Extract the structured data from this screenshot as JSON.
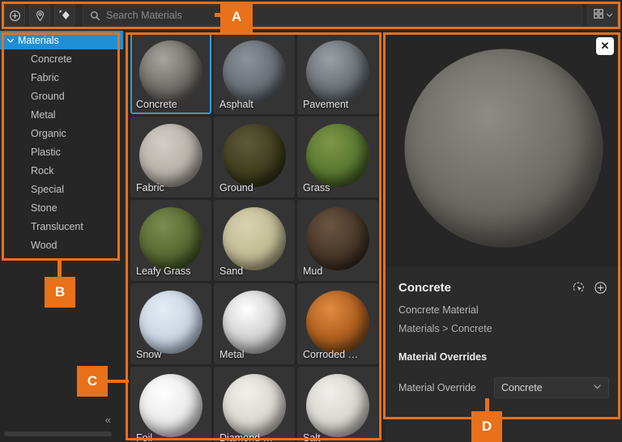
{
  "toolbar": {
    "buttons": [
      {
        "name": "add-material-button",
        "icon": "plus-circle-icon",
        "title": "Add"
      },
      {
        "name": "place-material-button",
        "icon": "pin-circle-icon",
        "title": "Place"
      },
      {
        "name": "pick-material-button",
        "icon": "diamond-cursor-icon",
        "title": "Pick"
      }
    ],
    "search": {
      "value": "",
      "placeholder": "Search Materials",
      "icon": "search-icon"
    },
    "view_button": {
      "name": "grid-view-button",
      "icon": "grid-view-icon",
      "chevron": "chevron-down-icon"
    }
  },
  "sidebar": {
    "root": {
      "label": "Materials",
      "caret": "chevron-down-icon",
      "selected": true
    },
    "items": [
      {
        "label": "Concrete"
      },
      {
        "label": "Fabric"
      },
      {
        "label": "Ground"
      },
      {
        "label": "Metal"
      },
      {
        "label": "Organic"
      },
      {
        "label": "Plastic"
      },
      {
        "label": "Rock"
      },
      {
        "label": "Special"
      },
      {
        "label": "Stone"
      },
      {
        "label": "Translucent"
      },
      {
        "label": "Wood"
      }
    ],
    "collapse_label": "«"
  },
  "grid": {
    "tiles": [
      {
        "label": "Concrete",
        "selected": true,
        "c1": "#a7a59f",
        "c2": "#72706b",
        "c3": "#54524e"
      },
      {
        "label": "Asphalt",
        "selected": false,
        "c1": "#8c9299",
        "c2": "#6a7077",
        "c3": "#4a4f55"
      },
      {
        "label": "Pavement",
        "selected": false,
        "c1": "#9aa0a6",
        "c2": "#6d7378",
        "c3": "#4d5257"
      },
      {
        "label": "Fabric",
        "selected": false,
        "c1": "#d3cdc7",
        "c2": "#b9b3ac",
        "c3": "#95908a"
      },
      {
        "label": "Ground",
        "selected": false,
        "c1": "#5d5a3c",
        "c2": "#42401f",
        "c3": "#2a2913"
      },
      {
        "label": "Grass",
        "selected": false,
        "c1": "#7d9548",
        "c2": "#5b7a32",
        "c3": "#3c531f"
      },
      {
        "label": "Leafy Grass",
        "selected": false,
        "c1": "#7d8b4e",
        "c2": "#5a6b33",
        "c3": "#3b4a22"
      },
      {
        "label": "Sand",
        "selected": false,
        "c1": "#d8d2b0",
        "c2": "#c2bc96",
        "c3": "#a39d78"
      },
      {
        "label": "Mud",
        "selected": false,
        "c1": "#6b5440",
        "c2": "#4a392a",
        "c3": "#2e241a"
      },
      {
        "label": "Snow",
        "selected": false,
        "c1": "#e4ebf3",
        "c2": "#ccd7e4",
        "c3": "#a9b6c6"
      },
      {
        "label": "Metal",
        "selected": false,
        "c1": "#ffffff",
        "c2": "#d2d2d2",
        "c3": "#a8a8a8"
      },
      {
        "label": "Corroded …",
        "selected": false,
        "c1": "#e08a42",
        "c2": "#b0601f",
        "c3": "#7a4718"
      },
      {
        "label": "Foil",
        "selected": false,
        "c1": "#ffffff",
        "c2": "#eaeaea",
        "c3": "#c6c6c6"
      },
      {
        "label": "Diamond …",
        "selected": false,
        "c1": "#f2f0ec",
        "c2": "#dcd9d3",
        "c3": "#b8b4ad"
      },
      {
        "label": "Salt",
        "selected": false,
        "c1": "#f0efeb",
        "c2": "#d9d8d2",
        "c3": "#b6b5ae"
      }
    ]
  },
  "detail": {
    "close_label": "✕",
    "preview": {
      "name": "material-preview-sphere",
      "c1": "#8d8b85",
      "c2": "#6e6c66",
      "c3": "#55534e"
    },
    "title": "Concrete",
    "subtitle": "Concrete Material",
    "path": "Materials > Concrete",
    "select_icon": "select-instances-icon",
    "add_icon": "plus-circle-icon",
    "overrides_title": "Material Overrides",
    "override_label": "Material Override",
    "override_value": "Concrete",
    "override_chevron": "chevron-down-icon"
  },
  "annotations": {
    "accent_color": "#e8711a",
    "labels": [
      {
        "id": "A",
        "target": "toolbar-region"
      },
      {
        "id": "B",
        "target": "sidebar-tree-region"
      },
      {
        "id": "C",
        "target": "material-grid-region"
      },
      {
        "id": "D",
        "target": "detail-panel-region"
      }
    ]
  }
}
